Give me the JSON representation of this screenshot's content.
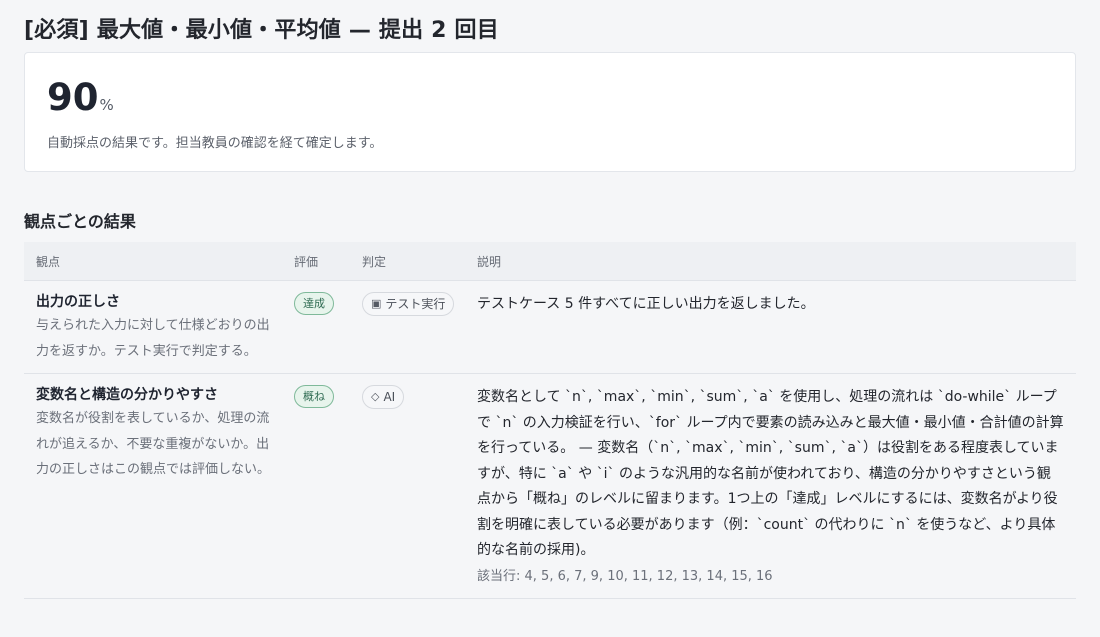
{
  "page": {
    "title": "[必須] 最大値・最小値・平均値 — 提出 2 回目"
  },
  "score": {
    "value": "90",
    "unit": "%",
    "note": "自動採点の結果です。担当教員の確認を経て確定します。"
  },
  "section": {
    "title": "観点ごとの結果"
  },
  "table": {
    "headers": {
      "aspect": "観点",
      "rating": "評価",
      "judge": "判定",
      "desc": "説明"
    },
    "rows": [
      {
        "name": "出力の正しさ",
        "description": "与えられた入力に対して仕様どおりの出力を返すか。テスト実行で判定する。",
        "rating": "達成",
        "judge_icon": "▣",
        "judge_icon_name": "test-run-icon",
        "judge_label": "テスト実行",
        "explanation": "テストケース 5 件すべてに正しい出力を返しました。",
        "lines": ""
      },
      {
        "name": "変数名と構造の分かりやすさ",
        "description": "変数名が役割を表しているか、処理の流れが追えるか、不要な重複がないか。出力の正しさはこの観点では評価しない。",
        "rating": "概ね",
        "judge_icon": "◇",
        "judge_icon_name": "ai-icon",
        "judge_label": "AI",
        "explanation": "変数名として `n`, `max`, `min`, `sum`, `a` を使用し、処理の流れは `do-while` ループで `n` の入力検証を行い、`for` ループ内で要素の読み込みと最大値・最小値・合計値の計算を行っている。 — 変数名（`n`, `max`, `min`, `sum`, `a`）は役割をある程度表していますが、特に `a` や `i` のような汎用的な名前が使われており、構造の分かりやすさという観点から「概ね」のレベルに留まります。1つ上の「達成」レベルにするには、変数名がより役割を明確に表している必要があります（例：`count` の代わりに `n` を使うなど、より具体的な名前の採用)。",
        "lines": "該当行: 4, 5, 6, 7, 9, 10, 11, 12, 13, 14, 15, 16"
      }
    ]
  },
  "colors": {
    "badge_text": "#2f6b52",
    "badge_bg": "#e7f4ec",
    "badge_border": "#7fb99a"
  }
}
